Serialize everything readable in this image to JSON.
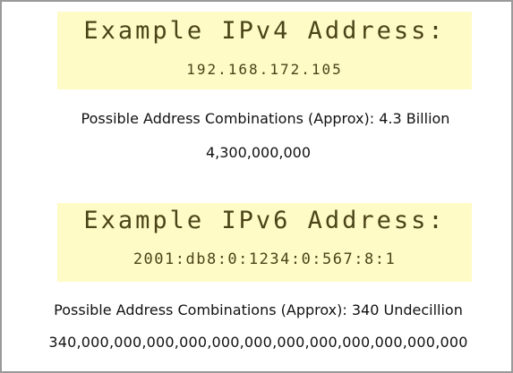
{
  "ipv4": {
    "heading": "Example IPv4 Address:",
    "address": "192.168.172.105",
    "combinations_label": "Possible Address Combinations (Approx): 4.3 Billion",
    "combinations_number": "4,300,000,000"
  },
  "ipv6": {
    "heading": "Example IPv6 Address:",
    "address": "2001:db8:0:1234:0:567:8:1",
    "combinations_label": "Possible Address Combinations (Approx): 340 Undecillion",
    "combinations_number": "340,000,000,000,000,000,000,000,000,000,000,000,000"
  },
  "colors": {
    "panel_background": "#fffbc6",
    "panel_text": "#4a4418",
    "body_text": "#111111",
    "frame_border": "#9a9a9a"
  }
}
